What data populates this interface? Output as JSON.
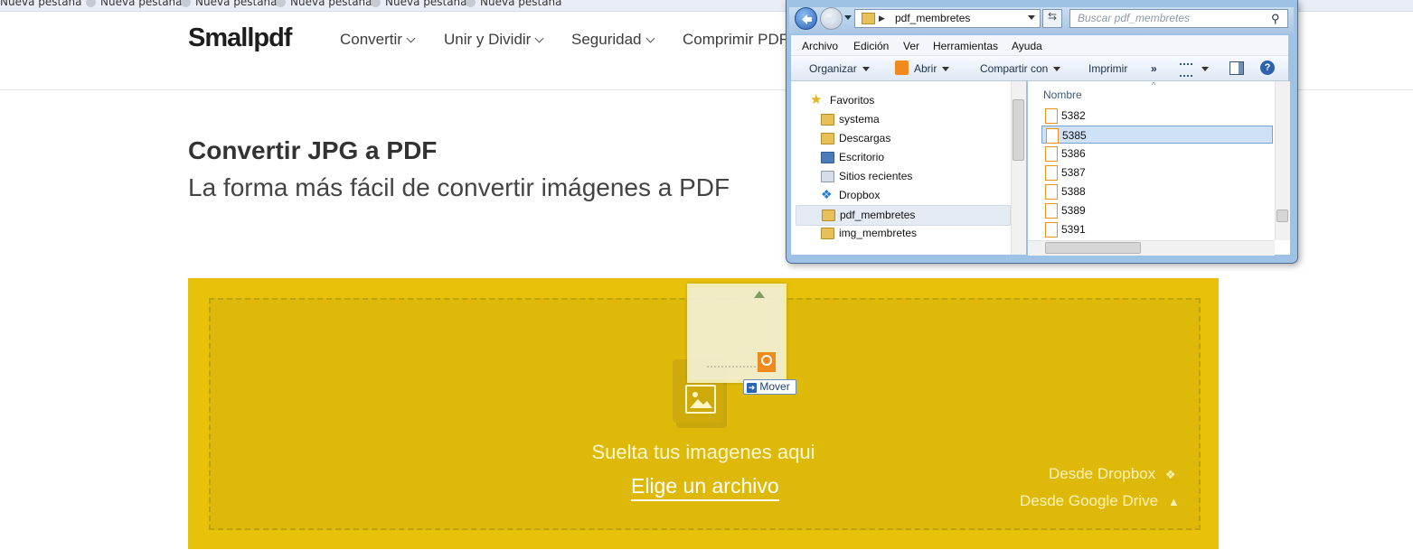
{
  "bookmarks": {
    "items": [
      "Nueva pestaña",
      "Nueva pestaña",
      "Nueva pestaña",
      "Nueva pestaña",
      "Nueva pestaña",
      "Nueva pestaña"
    ]
  },
  "site": {
    "logo": "Smallpdf",
    "nav": [
      "Convertir",
      "Unir y Dividir",
      "Seguridad",
      "Comprimir PDF"
    ],
    "title": "Convertir JPG a PDF",
    "subtitle": "La forma más fácil de convertir imágenes a PDF",
    "dropzone": {
      "prompt": "Suelta tus imagenes aqui",
      "choose_file": "Elige un archivo",
      "from_dropbox": "Desde Dropbox",
      "from_gdrive": "Desde Google Drive"
    },
    "drag_tooltip": "Mover",
    "colors": {
      "dropzone": "#e8c10a",
      "text_dark": "#333333"
    }
  },
  "explorer": {
    "address": "pdf_membretes",
    "search_placeholder": "Buscar pdf_membretes",
    "menu": [
      "Archivo",
      "Edición",
      "Ver",
      "Herramientas",
      "Ayuda"
    ],
    "toolbar": {
      "organize": "Organizar",
      "open": "Abrir",
      "share": "Compartir con",
      "print": "Imprimir",
      "more": "»"
    },
    "nav_favorites": "Favoritos",
    "nav_items": [
      "systema",
      "Descargas",
      "Escritorio",
      "Sitios recientes",
      "Dropbox",
      "pdf_membretes",
      "img_membretes"
    ],
    "nav_selected": "pdf_membretes",
    "column_header": "Nombre",
    "files": [
      "5382",
      "5385",
      "5386",
      "5387",
      "5388",
      "5389",
      "5391"
    ],
    "selected_file": "5385"
  }
}
